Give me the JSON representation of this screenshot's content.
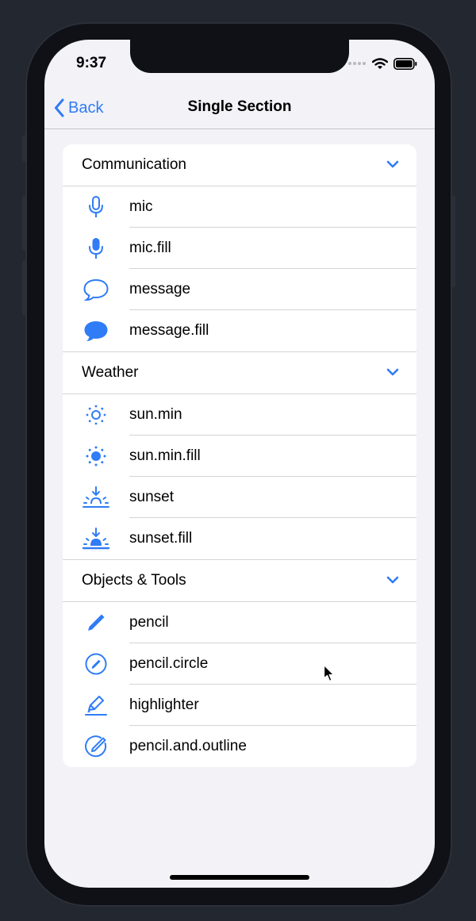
{
  "status": {
    "time": "9:37"
  },
  "nav": {
    "back_label": "Back",
    "title": "Single Section"
  },
  "sections": [
    {
      "title": "Communication",
      "items": [
        {
          "label": "mic",
          "icon": "mic-icon"
        },
        {
          "label": "mic.fill",
          "icon": "mic-fill-icon"
        },
        {
          "label": "message",
          "icon": "message-icon"
        },
        {
          "label": "message.fill",
          "icon": "message-fill-icon"
        }
      ]
    },
    {
      "title": "Weather",
      "items": [
        {
          "label": "sun.min",
          "icon": "sun-min-icon"
        },
        {
          "label": "sun.min.fill",
          "icon": "sun-min-fill-icon"
        },
        {
          "label": "sunset",
          "icon": "sunset-icon"
        },
        {
          "label": "sunset.fill",
          "icon": "sunset-fill-icon"
        }
      ]
    },
    {
      "title": "Objects & Tools",
      "items": [
        {
          "label": "pencil",
          "icon": "pencil-icon"
        },
        {
          "label": "pencil.circle",
          "icon": "pencil-circle-icon"
        },
        {
          "label": "highlighter",
          "icon": "highlighter-icon"
        },
        {
          "label": "pencil.and.outline",
          "icon": "pencil-and-outline-icon"
        }
      ]
    }
  ],
  "colors": {
    "accent": "#2f7cf6",
    "background": "#f2f2f7",
    "card": "#ffffff",
    "desktop": "#23272f"
  }
}
